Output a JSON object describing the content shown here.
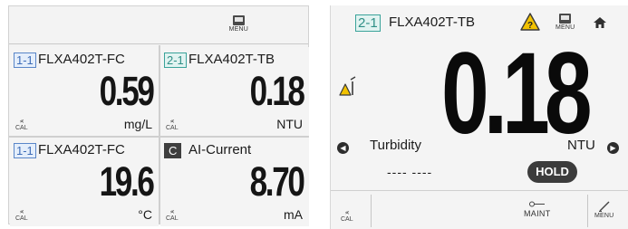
{
  "left_screen": {
    "menu_label": "MENU",
    "cells": [
      {
        "channel": "1-1",
        "tag": "FLXA402T-FC",
        "value": "0.59",
        "unit": "mg/L",
        "cal_label": "CAL"
      },
      {
        "channel": "2-1",
        "tag": "FLXA402T-TB",
        "value": "0.18",
        "unit": "NTU",
        "cal_label": "CAL"
      },
      {
        "channel": "1-1",
        "tag": "FLXA402T-FC",
        "value": "19.6",
        "unit": "°C",
        "cal_label": "CAL"
      },
      {
        "channel": "C",
        "tag": "AI-Current",
        "value": "8.70",
        "unit": "mA",
        "cal_label": "CAL"
      }
    ]
  },
  "right_screen": {
    "channel": "2-1",
    "tag": "FLXA402T-TB",
    "menu_label": "MENU",
    "value": "0.18",
    "parameter": "Turbidity",
    "unit": "NTU",
    "secondary_value": "---- ----",
    "hold_label": "HOLD",
    "bottom": {
      "cal_label": "CAL",
      "maint_label": "MAINT",
      "menu_label": "MENU"
    }
  },
  "colors": {
    "channel_blue": "#3f6db7",
    "channel_teal": "#2f8f86",
    "warning_yellow": "#f2c200",
    "hold_bg": "#3c3c3c"
  }
}
